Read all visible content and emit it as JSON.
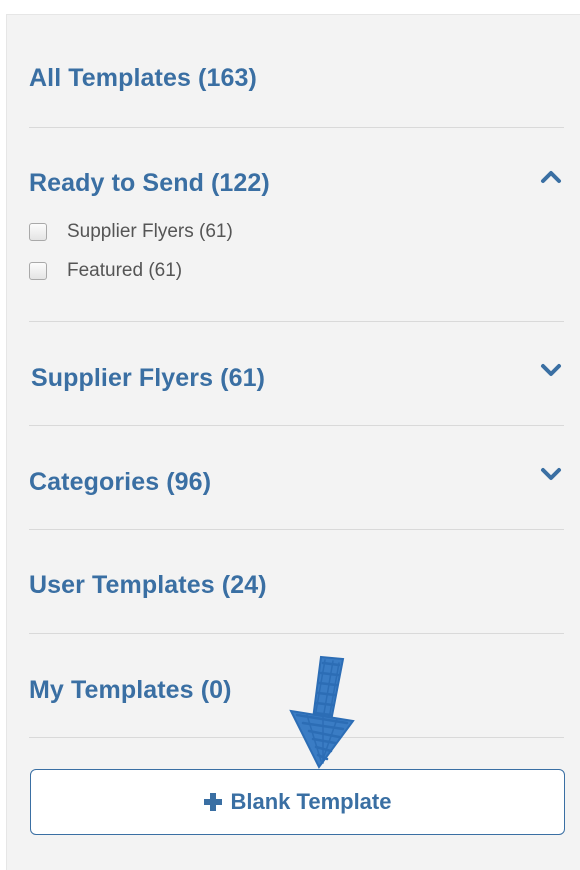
{
  "sidebar": {
    "all_templates": "All Templates (163)",
    "ready_to_send": {
      "label": "Ready to Send (122)",
      "expanded": true,
      "items": [
        {
          "label": "Supplier Flyers (61)",
          "checked": false
        },
        {
          "label": "Featured (61)",
          "checked": false
        }
      ]
    },
    "supplier_flyers": {
      "label": "Supplier Flyers (61)",
      "expanded": false
    },
    "categories": {
      "label": "Categories (96)",
      "expanded": false
    },
    "user_templates": "User Templates (24)",
    "my_templates": "My Templates (0)",
    "blank_template_button": "Blank Template"
  },
  "icons": {
    "expanded": "chevron-up-icon",
    "collapsed": "chevron-down-icon",
    "add": "plus-icon",
    "annotation": "hand-drawn-arrow-icon"
  },
  "colors": {
    "accent": "#3a6fa3",
    "panel_bg": "#f3f3f3",
    "divider": "#d9d9d9",
    "sub_text": "#555555",
    "annotation": "#2c6db5"
  }
}
